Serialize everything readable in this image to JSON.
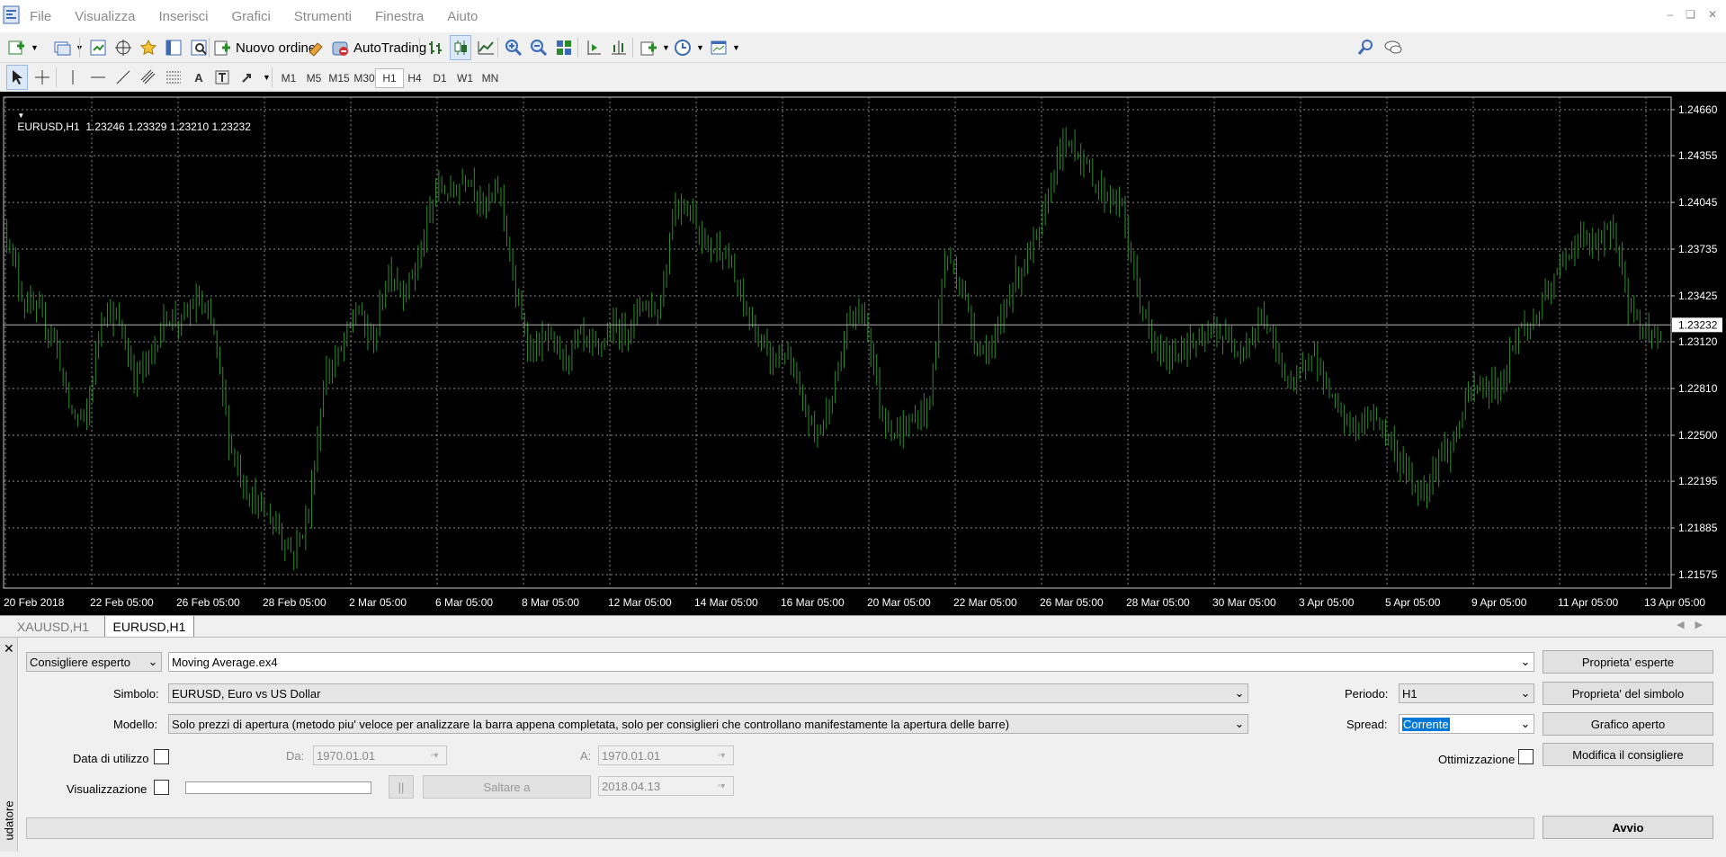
{
  "menu": [
    "File",
    "Visualizza",
    "Inserisci",
    "Grafici",
    "Strumenti",
    "Finestra",
    "Aiuto"
  ],
  "toolbar": {
    "new_order": "Nuovo ordine",
    "autotrading": "AutoTrading"
  },
  "timeframes": [
    "M1",
    "M5",
    "M15",
    "M30",
    "H1",
    "H4",
    "D1",
    "W1",
    "MN"
  ],
  "active_timeframe": "H1",
  "chart": {
    "header": "EURUSD,H1  1.23246 1.23329 1.23210 1.23232",
    "current_price_label": "1.23232"
  },
  "chart_data": {
    "type": "line",
    "series": [
      {
        "name": "EURUSD,H1",
        "color": "#2e8b2e"
      }
    ],
    "ylim": [
      1.215,
      1.248
    ],
    "yticks": [
      "1.24660",
      "1.24355",
      "1.24045",
      "1.23735",
      "1.23425",
      "1.23120",
      "1.22810",
      "1.22500",
      "1.22195",
      "1.21885",
      "1.21575"
    ],
    "xticks": [
      "20 Feb 2018",
      "22 Feb 05:00",
      "26 Feb 05:00",
      "28 Feb 05:00",
      "2 Mar 05:00",
      "6 Mar 05:00",
      "8 Mar 05:00",
      "12 Mar 05:00",
      "14 Mar 05:00",
      "16 Mar 05:00",
      "20 Mar 05:00",
      "22 Mar 05:00",
      "26 Mar 05:00",
      "28 Mar 05:00",
      "30 Mar 05:00",
      "3 Apr 05:00",
      "5 Apr 05:00",
      "9 Apr 05:00",
      "11 Apr 05:00",
      "13 Apr 05:00"
    ],
    "last_price": 1.23232,
    "grid": true,
    "price_path": [
      1.2385,
      1.234,
      1.233,
      1.2315,
      1.2265,
      1.226,
      1.2335,
      1.2325,
      1.229,
      1.23,
      1.233,
      1.2325,
      1.234,
      1.232,
      1.2245,
      1.2215,
      1.22,
      1.219,
      1.217,
      1.22,
      1.229,
      1.2305,
      1.2335,
      1.231,
      1.236,
      1.2345,
      1.237,
      1.2415,
      1.241,
      1.2425,
      1.24,
      1.2415,
      1.234,
      1.2305,
      1.2315,
      1.23,
      1.2315,
      1.2305,
      1.232,
      1.232,
      1.234,
      1.233,
      1.2405,
      1.24,
      1.2375,
      1.2375,
      1.2345,
      1.232,
      1.23,
      1.2305,
      1.227,
      1.225,
      1.228,
      1.233,
      1.233,
      1.2265,
      1.225,
      1.226,
      1.227,
      1.237,
      1.235,
      1.231,
      1.2305,
      1.2345,
      1.2365,
      1.2385,
      1.2435,
      1.2445,
      1.2425,
      1.241,
      1.2405,
      1.235,
      1.231,
      1.23,
      1.231,
      1.231,
      1.232,
      1.231,
      1.231,
      1.233,
      1.23,
      1.228,
      1.231,
      1.228,
      1.226,
      1.2255,
      1.2265,
      1.2245,
      1.2225,
      1.221,
      1.2235,
      1.2245,
      1.228,
      1.228,
      1.2285,
      1.232,
      1.2325,
      1.2345,
      1.237,
      1.238,
      1.2375,
      1.239,
      1.2335,
      1.232,
      1.2315
    ]
  },
  "chart_tabs": [
    "XAUUSD,H1",
    "EURUSD,H1"
  ],
  "active_chart_tab": "EURUSD,H1",
  "tester": {
    "side_label": "udatore",
    "mode": "Consigliere esperto",
    "expert": "Moving Average.ex4",
    "symbol_label": "Simbolo:",
    "symbol": "EURUSD, Euro vs US Dollar",
    "model_label": "Modello:",
    "model": "Solo prezzi di apertura (metodo piu' veloce per analizzare la barra appena completata, solo per consiglieri che controllano manifestamente la apertura delle barre)",
    "period_label": "Periodo:",
    "period": "H1",
    "spread_label": "Spread:",
    "spread": "Corrente",
    "use_date_label": "Data di utilizzo",
    "from_label": "Da:",
    "from": "1970.01.01",
    "to_label": "A:",
    "to": "1970.01.01",
    "visual_label": "Visualizzazione",
    "pause_label": "||",
    "skip_label": "Saltare a",
    "skip_date": "2018.04.13",
    "optimization_label": "Ottimizzazione",
    "btn_expert_props": "Proprieta' esperte",
    "btn_symbol_props": "Proprieta' del simbolo",
    "btn_open_chart": "Grafico aperto",
    "btn_modify_expert": "Modifica il consigliere",
    "btn_start": "Avvio",
    "progress": 0
  }
}
